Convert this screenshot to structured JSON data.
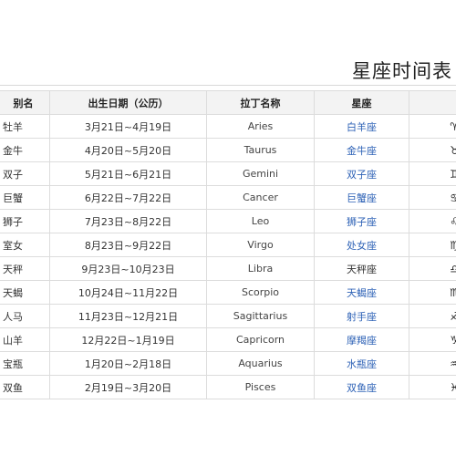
{
  "title": "星座时间表",
  "headers": {
    "alias": "别名",
    "date": "出生日期（公历）",
    "latin": "拉丁名称",
    "sign": "星座",
    "symbol": ""
  },
  "rows": [
    {
      "alias": "牡羊",
      "date": "3月21日~4月19日",
      "latin": "Aries",
      "sign": "白羊座",
      "linked": true,
      "symbol": "♈"
    },
    {
      "alias": "金牛",
      "date": "4月20日~5月20日",
      "latin": "Taurus",
      "sign": "金牛座",
      "linked": true,
      "symbol": "♉"
    },
    {
      "alias": "双子",
      "date": "5月21日~6月21日",
      "latin": "Gemini",
      "sign": "双子座",
      "linked": true,
      "symbol": "♊"
    },
    {
      "alias": "巨蟹",
      "date": "6月22日~7月22日",
      "latin": "Cancer",
      "sign": "巨蟹座",
      "linked": true,
      "symbol": "♋"
    },
    {
      "alias": "狮子",
      "date": "7月23日~8月22日",
      "latin": "Leo",
      "sign": "狮子座",
      "linked": true,
      "symbol": "♌"
    },
    {
      "alias": "室女",
      "date": "8月23日~9月22日",
      "latin": "Virgo",
      "sign": "处女座",
      "linked": true,
      "symbol": "♍"
    },
    {
      "alias": "天秤",
      "date": "9月23日~10月23日",
      "latin": "Libra",
      "sign": "天秤座",
      "linked": false,
      "symbol": "♎"
    },
    {
      "alias": "天蝎",
      "date": "10月24日~11月22日",
      "latin": "Scorpio",
      "sign": "天蝎座",
      "linked": true,
      "symbol": "♏"
    },
    {
      "alias": "人马",
      "date": "11月23日~12月21日",
      "latin": "Sagittarius",
      "sign": "射手座",
      "linked": true,
      "symbol": "♐"
    },
    {
      "alias": "山羊",
      "date": "12月22日~1月19日",
      "latin": "Capricorn",
      "sign": "摩羯座",
      "linked": true,
      "symbol": "♑"
    },
    {
      "alias": "宝瓶",
      "date": "1月20日~2月18日",
      "latin": "Aquarius",
      "sign": "水瓶座",
      "linked": true,
      "symbol": "♒"
    },
    {
      "alias": "双鱼",
      "date": "2月19日~3月20日",
      "latin": "Pisces",
      "sign": "双鱼座",
      "linked": true,
      "symbol": "♓"
    }
  ]
}
